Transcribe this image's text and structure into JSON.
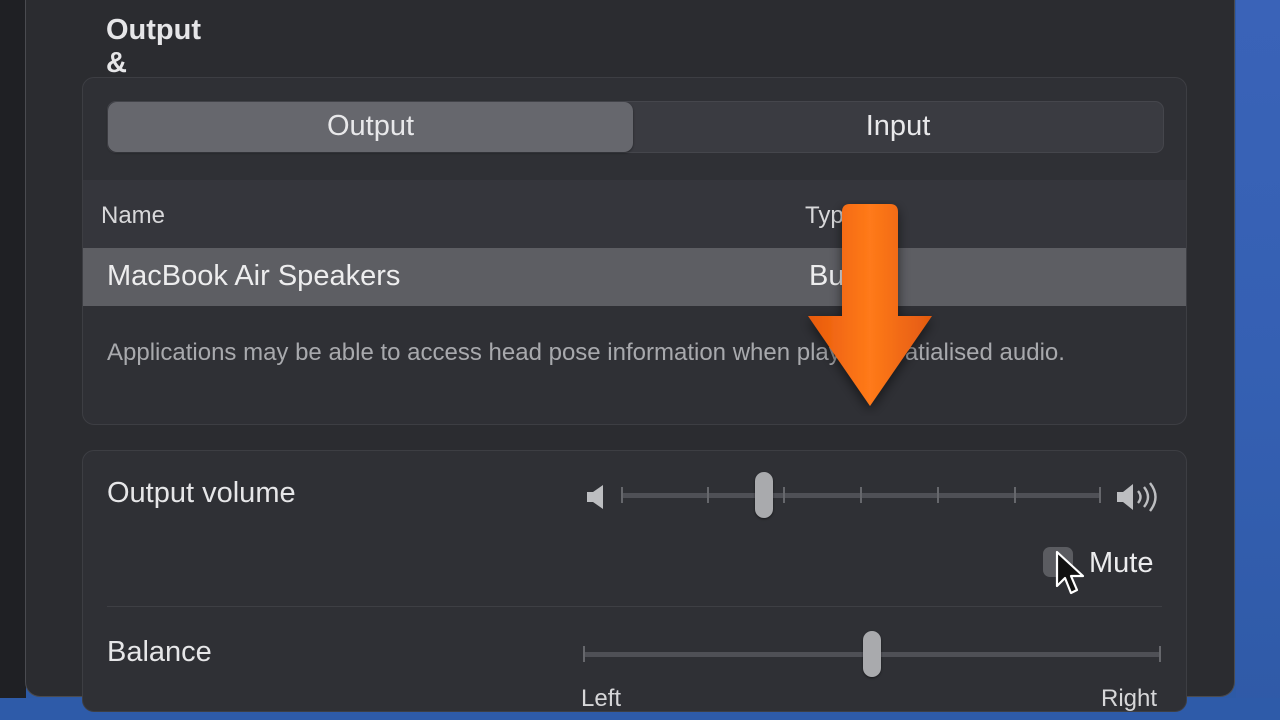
{
  "section": {
    "title": "Output & Input"
  },
  "tabs": [
    {
      "label": "Output",
      "selected": true
    },
    {
      "label": "Input",
      "selected": false
    }
  ],
  "table": {
    "headers": {
      "name": "Name",
      "type": "Type"
    },
    "rows": [
      {
        "name": "MacBook Air Speakers",
        "type": "Built-in",
        "selected": true
      }
    ]
  },
  "note": "Applications may be able to access head pose information when playing spatialised audio.",
  "output_volume": {
    "label": "Output volume",
    "level_fraction": 0.28
  },
  "mute": {
    "label": "Mute",
    "checked": false
  },
  "balance": {
    "label": "Balance",
    "left_label": "Left",
    "right_label": "Right",
    "position_fraction": 0.5
  },
  "annotation": {
    "arrow_color": "#f26a12"
  },
  "icons": [
    "speaker-low-icon",
    "speaker-high-icon",
    "cursor-icon",
    "down-arrow-icon"
  ]
}
